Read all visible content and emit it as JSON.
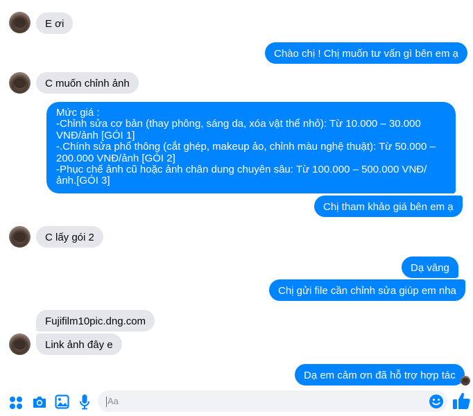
{
  "messages": [
    {
      "text": "E ơi"
    },
    {
      "text": "Chào chị ! Chị muốn tư vấn gì bên em ạ"
    },
    {
      "text": "C muốn chỉnh ảnh"
    },
    {
      "text": "Chị tham khảo giá bên em ạ"
    },
    {
      "text": "C lấy gói 2"
    },
    {
      "text": "Dạ vâng"
    },
    {
      "text": "Chị gửi file cần chỉnh sửa giúp em nha"
    },
    {
      "text": "Fujifilm10pic.dng.com"
    },
    {
      "text": "Link ảnh đây e"
    },
    {
      "text": "Dạ em cảm ơn đã hỗ trợ hợp tác"
    }
  ],
  "price_list": {
    "lines": [
      "Mức giá :",
      "-Chỉnh sửa cơ bản (thay phông, sáng da, xóa vật thể nhỏ): Từ 10.000 – 30.000 VNĐ/ảnh [GÓI 1]",
      "-.Chính sửa phổ thông (cắt ghép, makeup ảo, chỉnh màu nghệ thuật): Từ 50.000 – 200.000 VNĐ/ảnh [GÓI 2]",
      "-Phục chế ảnh cũ hoặc ảnh chân dung chuyên sâu: Từ 100.000 – 500.000 VNĐ/ảnh.[GÓI 3]"
    ]
  },
  "composer": {
    "placeholder": "Aa"
  },
  "colors": {
    "accent": "#0084ff",
    "incoming_bubble": "#e4e6eb"
  },
  "icons": [
    "grid-menu-icon",
    "camera-icon",
    "image-icon",
    "microphone-icon",
    "emoji-icon",
    "like-icon"
  ]
}
